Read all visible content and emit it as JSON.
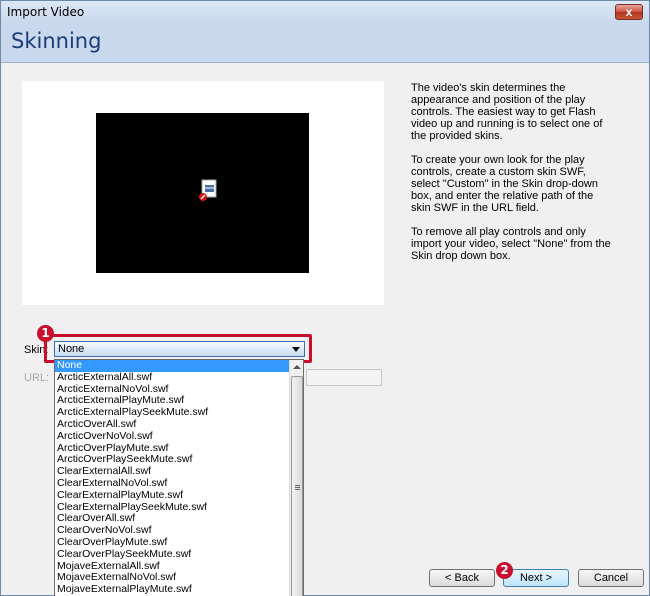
{
  "window": {
    "title": "Import Video",
    "close_label": "x"
  },
  "header": {
    "title": "Skinning"
  },
  "description": {
    "paragraphs": [
      "The video's skin determines the appearance and position of the play controls.  The easiest way to get Flash video up and running is to select one of the provided skins.",
      "To create your own look for the play controls, create a custom skin SWF, select \"Custom\" in the Skin drop-down box, and enter the relative path of the skin SWF in the URL field.",
      "To remove all play controls and only import your video, select \"None\" from the Skin drop down box."
    ]
  },
  "skin": {
    "label": "Skin:",
    "selected": "None",
    "options": [
      "None",
      "ArcticExternalAll.swf",
      "ArcticExternalNoVol.swf",
      "ArcticExternalPlayMute.swf",
      "ArcticExternalPlaySeekMute.swf",
      "ArcticOverAll.swf",
      "ArcticOverNoVol.swf",
      "ArcticOverPlayMute.swf",
      "ArcticOverPlaySeekMute.swf",
      "ClearExternalAll.swf",
      "ClearExternalNoVol.swf",
      "ClearExternalPlayMute.swf",
      "ClearExternalPlaySeekMute.swf",
      "ClearOverAll.swf",
      "ClearOverNoVol.swf",
      "ClearOverPlayMute.swf",
      "ClearOverPlaySeekMute.swf",
      "MojaveExternalAll.swf",
      "MojaveExternalNoVol.swf",
      "MojaveExternalPlayMute.swf"
    ]
  },
  "url": {
    "label": "URL:",
    "value": ""
  },
  "annotations": {
    "badge1": "1",
    "badge2": "2"
  },
  "buttons": {
    "back": "< Back",
    "next": "Next >",
    "cancel": "Cancel"
  },
  "colors": {
    "header_bg": "#c9d8ec",
    "heading": "#1a3d78",
    "highlight": "#c8102e",
    "selection": "#3399ff"
  },
  "icons": {
    "plugin": "missing-plugin-icon",
    "close": "close-icon",
    "dropdown": "chevron-down-icon"
  }
}
